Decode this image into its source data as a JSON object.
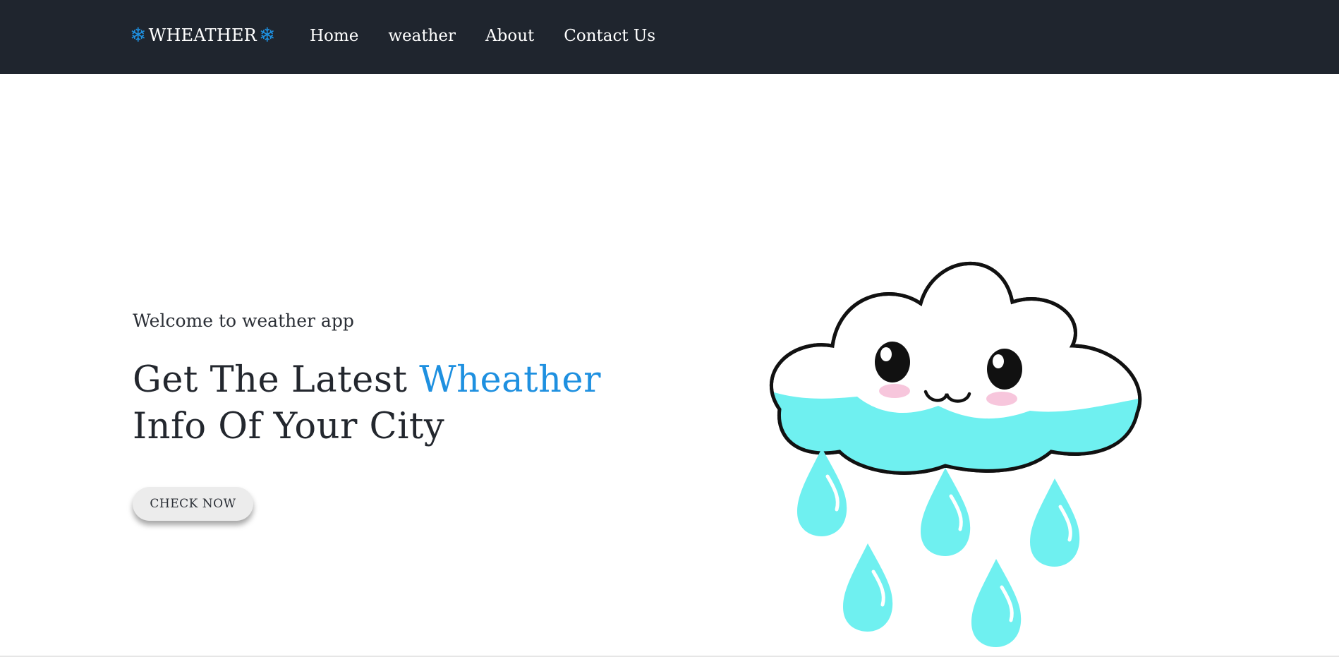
{
  "navbar": {
    "brand": "WHEATHER",
    "brand_icon": "snowflake-icon",
    "brand_icon_glyph": "❄",
    "links": [
      "Home",
      "weather",
      "About",
      "Contact Us"
    ]
  },
  "hero": {
    "welcome": "Welcome to weather app",
    "headline_pre": "Get The Latest ",
    "headline_accent": "Wheather",
    "headline_post": " Info Of Your City",
    "cta_label": "CHECK NOW"
  },
  "colors": {
    "navbar_bg": "#1f252e",
    "accent": "#1e90e0",
    "cloud_fill": "#ffffff",
    "cloud_band": "#6ff0f0",
    "raindrop": "#6ff0f0"
  },
  "illustration": {
    "icon": "cloud-rain-illustration"
  }
}
